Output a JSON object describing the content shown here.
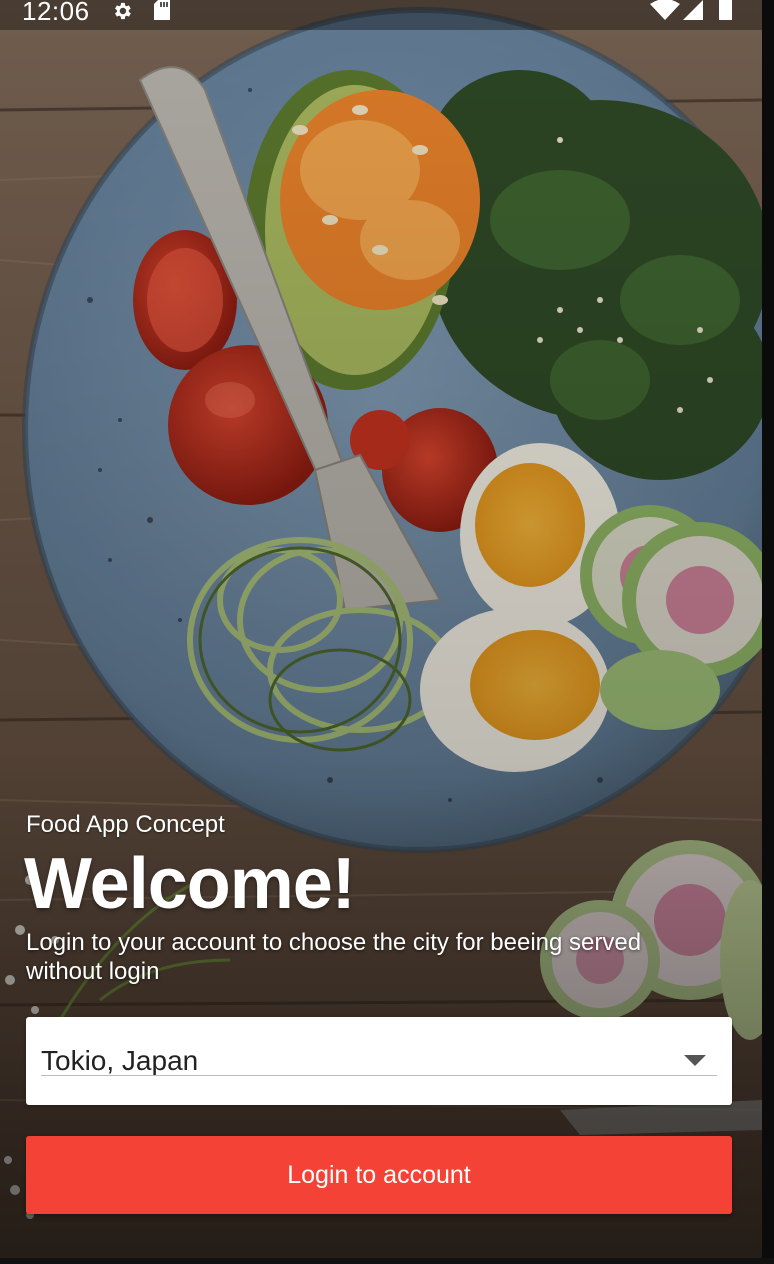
{
  "status_bar": {
    "time": "12:06",
    "icons": [
      "gear-icon",
      "sd-card-icon",
      "wifi-icon",
      "cell-signal-icon",
      "battery-icon"
    ]
  },
  "background": {
    "image": "food-bowl-photo",
    "colors": {
      "wood": "#6f5a48",
      "plate": "#6f8aa3"
    }
  },
  "intro": {
    "subtitle": "Food App Concept",
    "title": "Welcome!",
    "description": "Login to your account to choose the city for beeing served without login"
  },
  "city_select": {
    "value": "Tokio, Japan",
    "icon": "dropdown-arrow-icon"
  },
  "login_button": {
    "label": "Login to account",
    "color": "#f44336"
  }
}
